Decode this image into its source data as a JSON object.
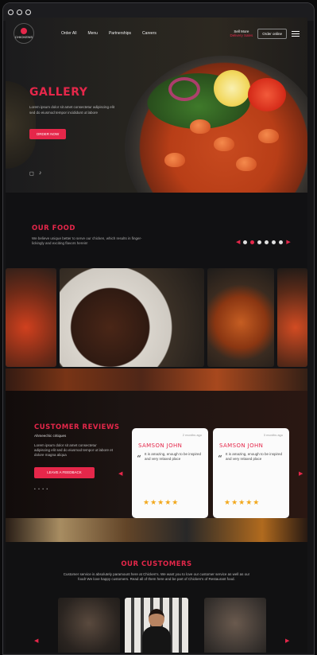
{
  "nav": {
    "logo_text": "CHICKENS",
    "links": [
      "Order All",
      "Menu",
      "Partnerships",
      "Careers"
    ],
    "signin_top": "Sell More",
    "signin_bottom": "Delivery Sales",
    "order_label": "Order online"
  },
  "hero": {
    "title": "GALLERY",
    "description": "Lorem ipsum dolor sit amet consectetur adipiscing elit sed do eiusmod tempor incididunt ut labore",
    "button": "ORDER NOW",
    "social_icons": [
      "instagram-icon",
      "tiktok-icon"
    ]
  },
  "food": {
    "title": "OUR FOOD",
    "description": "We believe unique better to serve our chicken, which results in finger-lickingly and exciting flavors herein!",
    "dots": 6,
    "active_dot": 1
  },
  "reviews": {
    "title": "CUSTOMER REVIEWS",
    "subtitle": "Ahmeechic critiques",
    "description": "Lorem ipsum dolor sit amet consectetur adipiscing elit sed do eiusmod tempor ut labore et dolore magna aliqua",
    "button": "LEAVE A FEEDBACK",
    "pager": "• • • •",
    "cards": [
      {
        "date": "2 months ago",
        "name": "SAMSON JOHN",
        "text": "It is amazing, enough to be inspired and very relaxed place",
        "stars": "★★★★★"
      },
      {
        "date": "3 months ago",
        "name": "SAMSON JOHN",
        "text": "It is amazing, enough to be inspired and very relaxed place",
        "stars": "★★★★★"
      }
    ]
  },
  "customers": {
    "title": "OUR CUSTOMERS",
    "description": "Customer service is absolutely paramount here at Chicken's. We want you to love our customer service as well as our food! We love happy customers. Read all of them here and be part of Chicken's of Restaurant food."
  },
  "colors": {
    "accent": "#e5274a",
    "star": "#f2a81d"
  }
}
